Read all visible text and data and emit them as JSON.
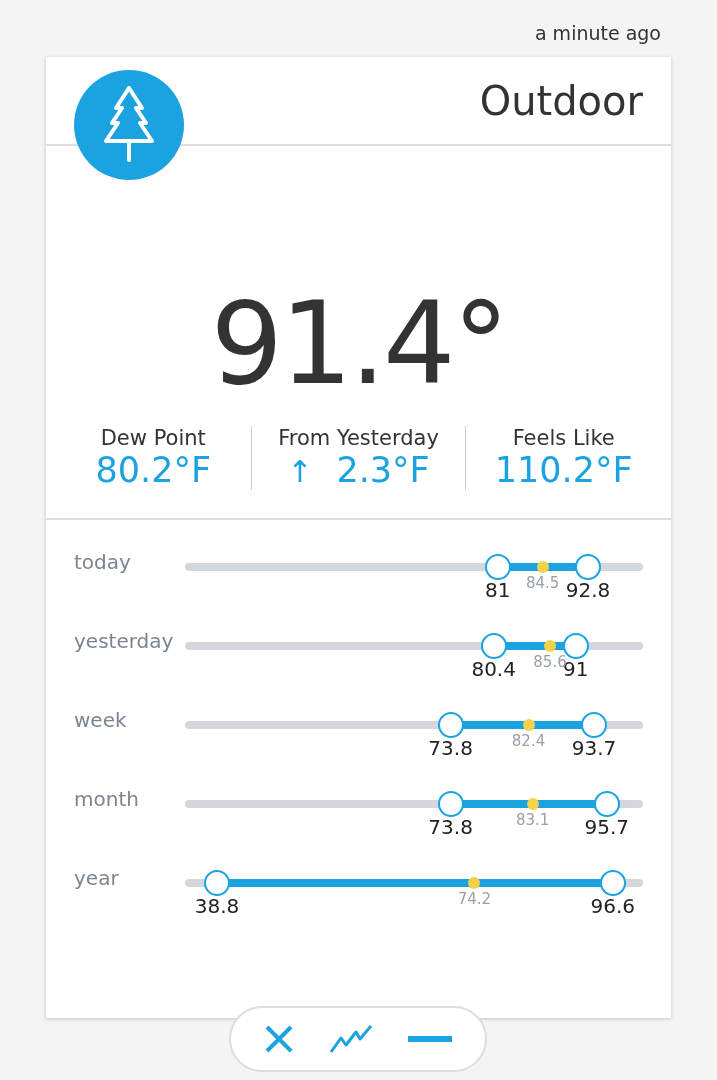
{
  "updated": "a minute ago",
  "card": {
    "title": "Outdoor",
    "temperature": "91.4°",
    "stats": [
      {
        "label": "Dew Point",
        "value": "80.2°F"
      },
      {
        "label": "From Yesterday",
        "arrow": "↑",
        "value": "2.3°F"
      },
      {
        "label": "Feels Like",
        "value": "110.2°F"
      }
    ],
    "ranges": [
      {
        "label": "today",
        "low": {
          "value": "81",
          "level": 0.683
        },
        "average": {
          "value": "84.5",
          "level": 0.781
        },
        "high": {
          "value": "92.8",
          "level": 0.88
        }
      },
      {
        "label": "yesterday",
        "low": {
          "value": "80.4",
          "level": 0.674
        },
        "average": {
          "value": "85.6",
          "level": 0.797
        },
        "high": {
          "value": "91",
          "level": 0.853
        }
      },
      {
        "label": "week",
        "low": {
          "value": "73.8",
          "level": 0.58
        },
        "average": {
          "value": "82.4",
          "level": 0.75
        },
        "high": {
          "value": "93.7",
          "level": 0.893
        }
      },
      {
        "label": "month",
        "low": {
          "value": "73.8",
          "level": 0.58
        },
        "average": {
          "value": "83.1",
          "level": 0.759
        },
        "high": {
          "value": "95.7",
          "level": 0.921
        }
      },
      {
        "label": "year",
        "low": {
          "value": "38.8",
          "level": 0.07
        },
        "average": {
          "value": "74.2",
          "level": 0.632
        },
        "high": {
          "value": "96.6",
          "level": 0.934
        }
      }
    ]
  },
  "toolbar": [
    {
      "kind": "close"
    },
    {
      "kind": "chart"
    },
    {
      "kind": "minimize"
    }
  ]
}
